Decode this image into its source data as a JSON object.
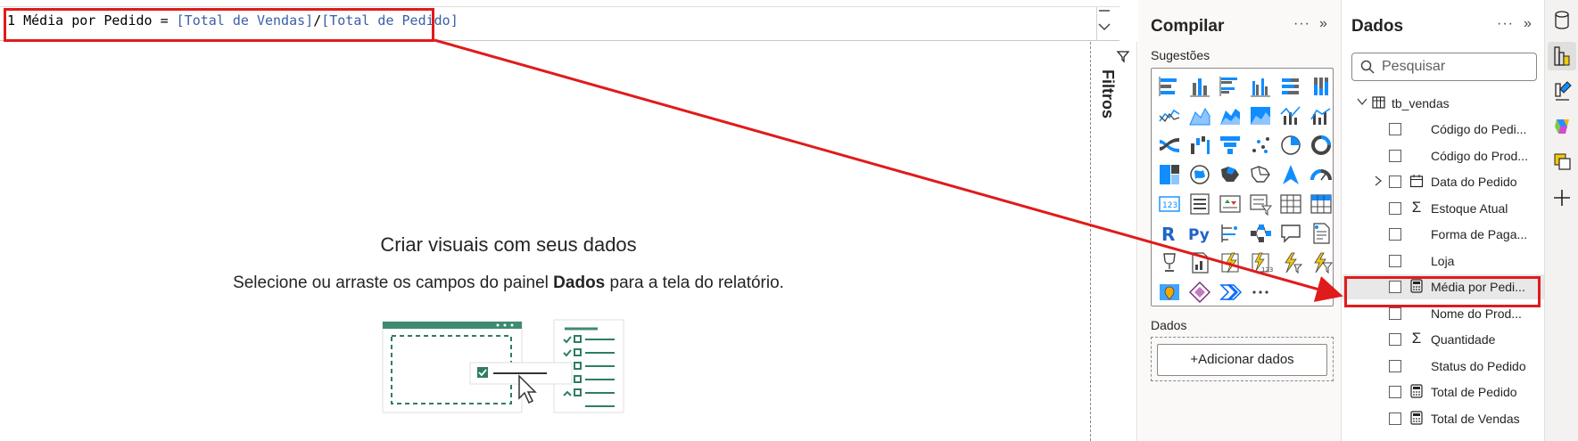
{
  "formula": {
    "line_number": "1",
    "measure_name": "Média por Pedido",
    "operator": " = ",
    "ref1": "[Total de Vendas]",
    "divider": "/",
    "ref2": "[Total de Pedido]"
  },
  "canvas": {
    "title": "Criar visuais com seus dados",
    "subtitle_before": "Selecione ou arraste os campos do painel ",
    "subtitle_bold": "Dados",
    "subtitle_after": " para a tela do relatório."
  },
  "filters": {
    "label": "Filtros"
  },
  "build_pane": {
    "title": "Compilar",
    "suggestions_label": "Sugestões",
    "data_label": "Dados",
    "add_data_button": "+Adicionar dados"
  },
  "data_pane": {
    "title": "Dados",
    "search_placeholder": "Pesquisar",
    "table_name": "tb_vendas",
    "fields": [
      {
        "label": "Código do Pedi...",
        "icon": ""
      },
      {
        "label": "Código do Prod...",
        "icon": ""
      },
      {
        "label": "Data do Pedido",
        "icon": "calendar-icon"
      },
      {
        "label": "Estoque Atual",
        "icon": "sigma-icon"
      },
      {
        "label": "Forma de Paga...",
        "icon": ""
      },
      {
        "label": "Loja",
        "icon": ""
      },
      {
        "label": "Média por Pedi...",
        "icon": "calculator-icon"
      },
      {
        "label": "Nome do Prod...",
        "icon": ""
      },
      {
        "label": "Quantidade",
        "icon": "sigma-icon"
      },
      {
        "label": "Status do Pedido",
        "icon": ""
      },
      {
        "label": "Total de Pedido",
        "icon": "calculator-icon"
      },
      {
        "label": "Total de Vendas",
        "icon": "calculator-icon"
      }
    ]
  },
  "colors": {
    "highlight": "#e01b1b",
    "accent": "#118dff",
    "selected_row": "#e8e8e8"
  }
}
